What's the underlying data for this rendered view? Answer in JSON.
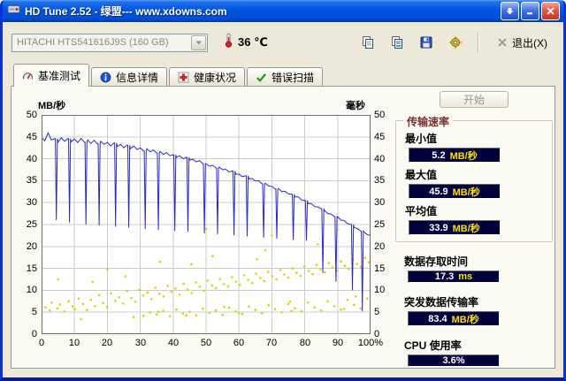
{
  "window": {
    "title": "HD Tune 2.52 - 绿盟--- www.xdowns.com"
  },
  "toolbar": {
    "drive_select": "HITACHI HTS541616J9S (160 GB)",
    "temperature": {
      "value": "36",
      "unit": "℃"
    },
    "exit_label": "退出(X)"
  },
  "tabs": [
    {
      "label": "基准测试"
    },
    {
      "label": "信息详情"
    },
    {
      "label": "健康状况"
    },
    {
      "label": "错误扫描"
    }
  ],
  "right_panel": {
    "start_label": "开始"
  },
  "results": {
    "transfer_group_title": "传输速率",
    "min_label": "最小值",
    "min_value": "5.2",
    "min_unit": "MB/秒",
    "max_label": "最大值",
    "max_value": "45.9",
    "max_unit": "MB/秒",
    "avg_label": "平均值",
    "avg_value": "33.9",
    "avg_unit": "MB/秒",
    "access_label": "数据存取时间",
    "access_value": "17.3",
    "access_unit": "ms",
    "burst_label": "突发数据传输率",
    "burst_value": "83.4",
    "burst_unit": "MB/秒",
    "cpu_label": "CPU 使用率",
    "cpu_value": "3.6%"
  },
  "chart_data": {
    "type": "line",
    "left_axis_label": "MB/秒",
    "right_axis_label": "毫秒",
    "ylim": [
      0,
      50
    ],
    "xlim": [
      0,
      100
    ],
    "y_ticks": [
      50,
      45,
      40,
      35,
      30,
      25,
      20,
      15,
      10,
      5,
      0
    ],
    "x_ticks": [
      "0",
      "10",
      "20",
      "30",
      "40",
      "50",
      "60",
      "70",
      "80",
      "90",
      "100%"
    ],
    "grid": true,
    "transfer_series": {
      "name": "传输速率",
      "color": "#2a2ac8",
      "x_step": 1,
      "values": [
        44.8,
        44.1,
        45.9,
        44.3,
        44.6,
        43.8,
        44.8,
        44.0,
        44.6,
        43.9,
        44.5,
        43.7,
        44.6,
        43.8,
        44.3,
        43.5,
        44.2,
        43.4,
        44.0,
        43.3,
        43.7,
        42.9,
        43.6,
        42.8,
        43.3,
        42.5,
        43.1,
        42.3,
        42.9,
        42.1,
        42.5,
        41.8,
        42.3,
        41.6,
        42.0,
        41.3,
        41.7,
        41.0,
        41.4,
        40.7,
        40.9,
        40.3,
        40.7,
        40.0,
        40.3,
        39.7,
        39.9,
        39.3,
        39.6,
        38.9,
        38.9,
        38.3,
        38.5,
        37.9,
        38.1,
        37.5,
        37.6,
        37.0,
        37.2,
        36.5,
        36.5,
        35.9,
        36.1,
        35.4,
        35.5,
        34.9,
        35.0,
        34.3,
        34.4,
        33.8,
        33.7,
        33.1,
        33.2,
        32.5,
        32.6,
        32.0,
        31.9,
        31.3,
        31.3,
        30.6,
        30.5,
        29.8,
        29.8,
        29.1,
        29.0,
        28.6,
        28.2,
        27.5,
        27.4,
        26.8,
        26.8,
        26.0,
        25.9,
        25.2,
        25.0,
        24.3,
        24.1,
        23.5,
        23.3,
        22.7,
        22.5
      ],
      "spikes": [
        [
          4,
          26.0
        ],
        [
          8,
          25.5
        ],
        [
          13,
          25.0
        ],
        [
          17,
          24.8
        ],
        [
          22,
          24.5
        ],
        [
          26,
          24.3
        ],
        [
          31,
          24.0
        ],
        [
          35,
          23.8
        ],
        [
          40,
          23.5
        ],
        [
          44,
          23.3
        ],
        [
          49,
          23.0
        ],
        [
          53,
          22.8
        ],
        [
          58,
          22.5
        ],
        [
          62,
          22.3
        ],
        [
          67,
          22.0
        ],
        [
          71,
          21.8
        ],
        [
          76,
          21.5
        ],
        [
          80,
          21.3
        ],
        [
          85,
          14.0
        ],
        [
          89,
          12.0
        ],
        [
          94,
          10.0
        ],
        [
          97,
          5.2
        ]
      ]
    },
    "access_points": {
      "name": "存取时间",
      "color": "#d6d600",
      "points": [
        [
          1.2,
          6.1
        ],
        [
          2.5,
          5.4
        ],
        [
          3.1,
          7.2
        ],
        [
          4.8,
          5.9
        ],
        [
          5.6,
          6.8
        ],
        [
          6.9,
          5.2
        ],
        [
          8.2,
          7.5
        ],
        [
          9.4,
          6.3
        ],
        [
          10.1,
          5.7
        ],
        [
          11.3,
          8.1
        ],
        [
          12.6,
          6.9
        ],
        [
          13.8,
          5.5
        ],
        [
          15.0,
          7.8
        ],
        [
          16.2,
          6.4
        ],
        [
          17.5,
          8.9
        ],
        [
          18.7,
          7.1
        ],
        [
          19.9,
          6.2
        ],
        [
          21.1,
          9.3
        ],
        [
          22.4,
          7.6
        ],
        [
          23.6,
          8.4
        ],
        [
          24.8,
          7.0
        ],
        [
          26.0,
          9.8
        ],
        [
          27.3,
          8.2
        ],
        [
          28.5,
          7.4
        ],
        [
          29.7,
          10.1
        ],
        [
          30.9,
          8.8
        ],
        [
          32.2,
          9.5
        ],
        [
          33.4,
          8.0
        ],
        [
          34.6,
          10.6
        ],
        [
          35.8,
          9.2
        ],
        [
          37.1,
          8.6
        ],
        [
          38.3,
          11.0
        ],
        [
          39.5,
          9.7
        ],
        [
          40.7,
          10.4
        ],
        [
          42.0,
          9.0
        ],
        [
          43.2,
          11.5
        ],
        [
          44.4,
          10.2
        ],
        [
          45.6,
          9.4
        ],
        [
          46.9,
          11.8
        ],
        [
          48.1,
          10.8
        ],
        [
          49.3,
          9.9
        ],
        [
          50.5,
          12.2
        ],
        [
          51.8,
          11.1
        ],
        [
          53.0,
          10.5
        ],
        [
          54.2,
          12.6
        ],
        [
          55.4,
          11.4
        ],
        [
          56.7,
          10.9
        ],
        [
          57.9,
          13.0
        ],
        [
          59.1,
          12.0
        ],
        [
          60.3,
          11.2
        ],
        [
          61.6,
          13.4
        ],
        [
          62.8,
          12.4
        ],
        [
          64.0,
          11.7
        ],
        [
          65.2,
          13.8
        ],
        [
          66.5,
          12.8
        ],
        [
          67.7,
          12.1
        ],
        [
          68.9,
          14.2
        ],
        [
          70.1,
          13.2
        ],
        [
          71.4,
          12.5
        ],
        [
          72.6,
          14.6
        ],
        [
          73.8,
          13.6
        ],
        [
          75.0,
          12.9
        ],
        [
          76.3,
          15.0
        ],
        [
          77.5,
          14.0
        ],
        [
          78.7,
          13.3
        ],
        [
          79.9,
          15.4
        ],
        [
          81.2,
          14.4
        ],
        [
          82.4,
          13.7
        ],
        [
          83.6,
          15.8
        ],
        [
          84.8,
          14.8
        ],
        [
          86.1,
          14.1
        ],
        [
          87.3,
          16.2
        ],
        [
          88.5,
          15.2
        ],
        [
          89.7,
          14.5
        ],
        [
          91.0,
          16.6
        ],
        [
          92.2,
          15.6
        ],
        [
          93.4,
          14.9
        ],
        [
          94.6,
          17.0
        ],
        [
          95.9,
          16.0
        ],
        [
          97.1,
          15.3
        ],
        [
          98.3,
          17.4
        ],
        [
          99.5,
          16.4
        ],
        [
          5.0,
          12.5
        ],
        [
          12.0,
          3.4
        ],
        [
          20.0,
          14.8
        ],
        [
          28.0,
          3.9
        ],
        [
          36.0,
          16.5
        ],
        [
          44.0,
          4.3
        ],
        [
          52.0,
          17.8
        ],
        [
          60.0,
          4.8
        ],
        [
          68.0,
          19.2
        ],
        [
          76.0,
          5.3
        ],
        [
          84.0,
          20.5
        ],
        [
          92.0,
          5.8
        ],
        [
          15.5,
          11.9
        ],
        [
          25.5,
          13.2
        ],
        [
          35.5,
          5.1
        ],
        [
          45.5,
          15.9
        ],
        [
          55.5,
          6.2
        ],
        [
          65.5,
          17.1
        ],
        [
          75.5,
          7.4
        ],
        [
          85.5,
          18.3
        ],
        [
          95.5,
          8.6
        ],
        [
          50.0,
          24.0
        ],
        [
          70.0,
          22.5
        ],
        [
          90.0,
          23.8
        ],
        [
          31,
          4.2
        ],
        [
          33,
          5.0
        ],
        [
          35,
          4.5
        ],
        [
          37,
          5.3
        ],
        [
          39,
          4.1
        ],
        [
          41,
          5.6
        ],
        [
          43,
          4.7
        ],
        [
          45,
          5.1
        ],
        [
          47,
          4.3
        ],
        [
          49,
          5.8
        ],
        [
          51,
          4.9
        ],
        [
          53,
          5.4
        ],
        [
          55,
          4.4
        ],
        [
          57,
          6.0
        ],
        [
          59,
          5.2
        ],
        [
          61,
          4.6
        ],
        [
          63,
          6.3
        ],
        [
          65,
          5.5
        ],
        [
          67,
          4.8
        ],
        [
          69,
          6.6
        ],
        [
          71,
          5.7
        ],
        [
          73,
          5.0
        ],
        [
          75,
          6.9
        ],
        [
          77,
          5.9
        ],
        [
          79,
          5.2
        ],
        [
          81,
          7.2
        ],
        [
          83,
          6.1
        ],
        [
          85,
          5.4
        ],
        [
          87,
          7.5
        ],
        [
          89,
          6.4
        ],
        [
          91,
          5.6
        ],
        [
          93,
          7.8
        ],
        [
          95,
          6.7
        ],
        [
          97,
          5.9
        ],
        [
          99,
          8.1
        ]
      ]
    }
  }
}
